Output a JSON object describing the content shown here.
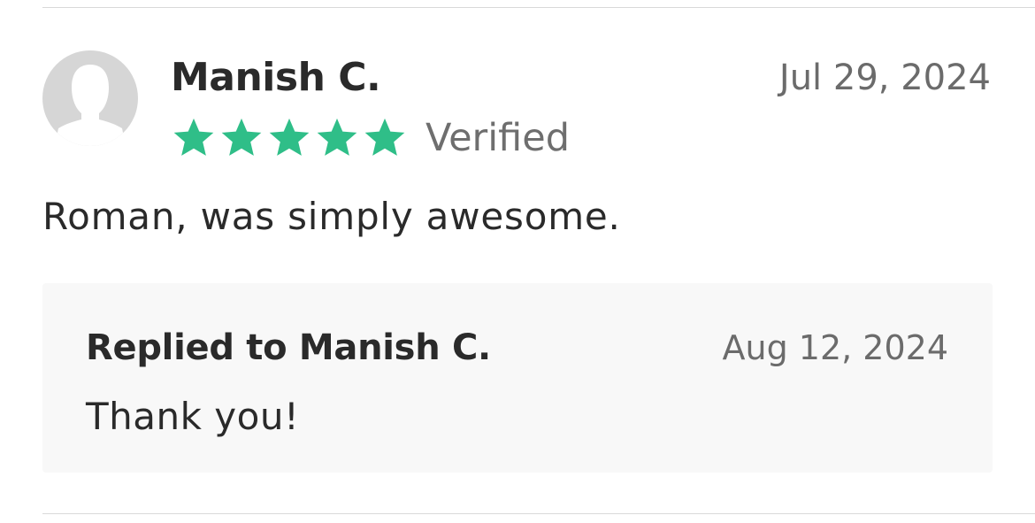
{
  "review": {
    "reviewer_name": "Manish C.",
    "date": "Jul 29, 2024",
    "rating": 5,
    "rating_max": 5,
    "verified_label": "Verified",
    "text": "Roman, was simply awesome.",
    "avatar_icon": "user-silhouette-icon",
    "star_icon": "star-icon"
  },
  "reply": {
    "title": "Replied to Manish C.",
    "date": "Aug 12, 2024",
    "text": "Thank you!"
  },
  "colors": {
    "star": "#2fbe88",
    "avatar_bg": "#d6d6d6",
    "avatar_fg": "#ffffff",
    "reply_bg": "#f8f8f8",
    "divider": "#d9d9d9"
  }
}
